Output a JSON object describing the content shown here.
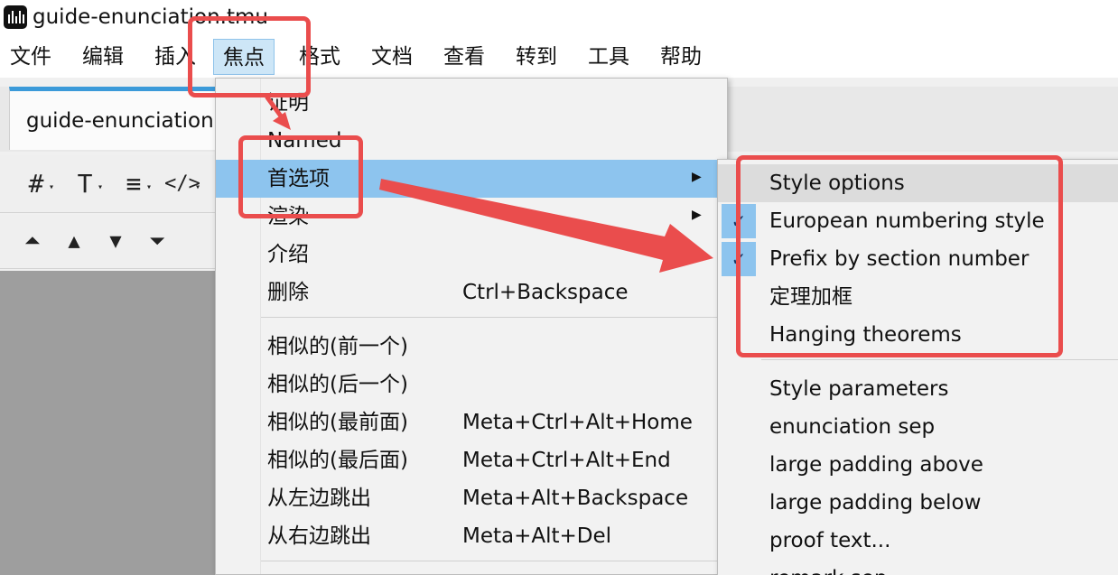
{
  "window": {
    "title": "guide-enunciation.tmu"
  },
  "menubar": {
    "items": [
      {
        "label": "文件"
      },
      {
        "label": "编辑"
      },
      {
        "label": "插入"
      },
      {
        "label": "焦点"
      },
      {
        "label": "格式"
      },
      {
        "label": "文档"
      },
      {
        "label": "查看"
      },
      {
        "label": "转到"
      },
      {
        "label": "工具"
      },
      {
        "label": "帮助"
      }
    ],
    "active": "焦点"
  },
  "tab": {
    "label": "guide-enunciation"
  },
  "menu": {
    "items": [
      {
        "label": "证明",
        "shortcut": ""
      },
      {
        "label": "Named",
        "shortcut": ""
      },
      {
        "label": "首选项",
        "shortcut": ""
      },
      {
        "label": "渲染",
        "shortcut": ""
      },
      {
        "label": "介绍",
        "shortcut": ""
      },
      {
        "label": "删除",
        "shortcut": "Ctrl+Backspace"
      },
      {
        "label": "相似的(前一个)",
        "shortcut": ""
      },
      {
        "label": "相似的(后一个)",
        "shortcut": ""
      },
      {
        "label": "相似的(最前面)",
        "shortcut": "Meta+Ctrl+Alt+Home"
      },
      {
        "label": "相似的(最后面)",
        "shortcut": "Meta+Ctrl+Alt+End"
      },
      {
        "label": "从左边跳出",
        "shortcut": "Meta+Alt+Backspace"
      },
      {
        "label": "从右边跳出",
        "shortcut": "Meta+Alt+Del"
      }
    ],
    "highlighted": "首选项"
  },
  "submenu": {
    "items": [
      {
        "label": "Style options",
        "checked": false
      },
      {
        "label": "European numbering style",
        "checked": true
      },
      {
        "label": "Prefix by section number",
        "checked": true
      },
      {
        "label": "定理加框",
        "checked": false
      },
      {
        "label": "Hanging theorems",
        "checked": false
      },
      {
        "label": "Style parameters",
        "checked": false
      },
      {
        "label": "enunciation sep",
        "checked": false
      },
      {
        "label": "large padding above",
        "checked": false
      },
      {
        "label": "large padding below",
        "checked": false
      },
      {
        "label": "proof text...",
        "checked": false
      },
      {
        "label": "remark sep",
        "checked": false
      }
    ]
  },
  "icons": {
    "checkmark": "✓",
    "submenu_arrow": "▶",
    "toolbar": [
      "grid-icon",
      "text-frame-icon",
      "list-icon",
      "code-icon",
      "move-top-icon",
      "move-up-icon",
      "move-down-icon",
      "move-bottom-icon"
    ]
  },
  "colors": {
    "highlight": "#8dc4ee",
    "annotation": "#ea4d4d",
    "tab_accent": "#3b9ad9"
  }
}
